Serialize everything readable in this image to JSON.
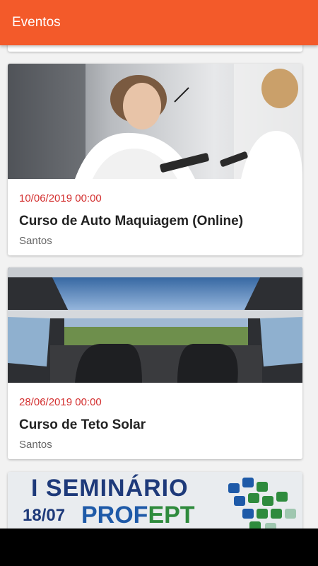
{
  "appbar": {
    "title": "Eventos"
  },
  "events": [
    {
      "date": "10/06/2019 00:00",
      "title": "Curso de Auto Maquiagem (Online)",
      "city": "Santos",
      "image": "woman-makeup-mirror-photo"
    },
    {
      "date": "28/06/2019 00:00",
      "title": "Curso de Teto Solar",
      "city": "Santos",
      "image": "car-sunroof-interior-photo"
    }
  ],
  "banner": {
    "line1": "I SEMINÁRIO",
    "line2": "18/07",
    "line3_a": "PROF",
    "line3_b": "EPT"
  },
  "colors": {
    "appbar": "#f35a2a",
    "date": "#d32f2f"
  }
}
